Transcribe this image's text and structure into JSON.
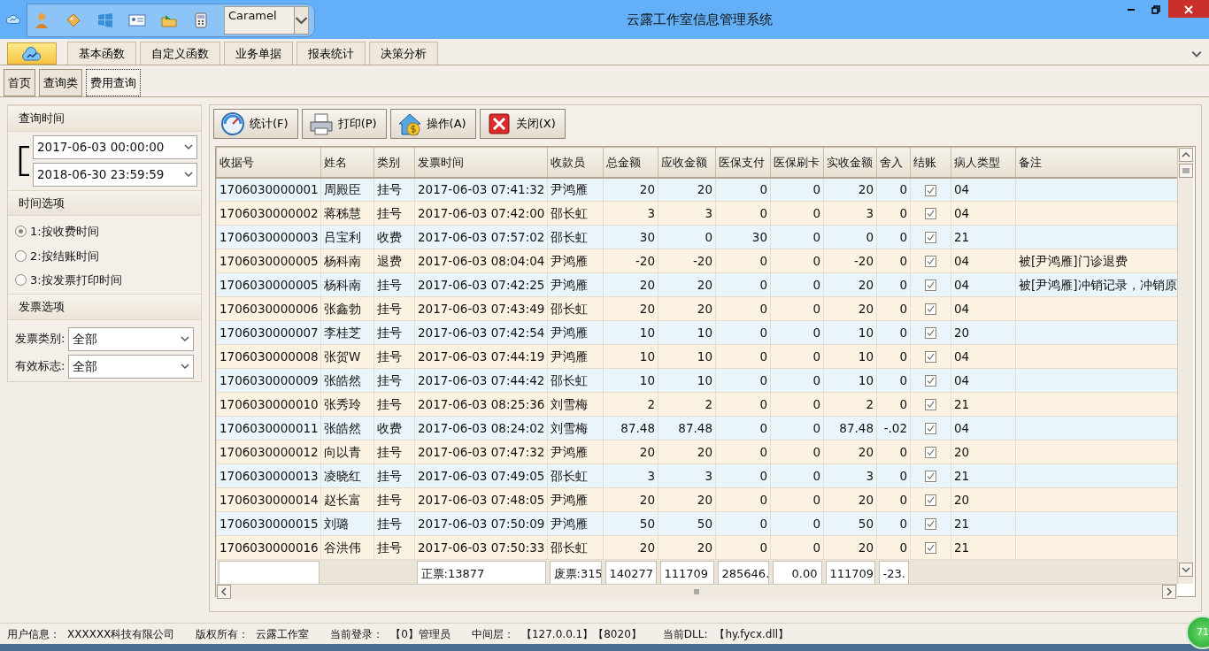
{
  "window": {
    "title": "云露工作室信息管理系统",
    "theme": "Caramel"
  },
  "ribbon_tabs": [
    {
      "label": "基本函数",
      "selected": false
    },
    {
      "label": "自定义函数",
      "selected": false
    },
    {
      "label": "业务单据",
      "selected": false
    },
    {
      "label": "报表统计",
      "selected": false
    },
    {
      "label": "决策分析",
      "selected": false
    }
  ],
  "doc_tabs": [
    {
      "label": "首页",
      "selected": false
    },
    {
      "label": "查询类",
      "selected": false
    },
    {
      "label": "费用查询",
      "selected": true
    }
  ],
  "query_time": {
    "title": "查询时间",
    "start": "2017-06-03 00:00:00",
    "end": "2018-06-30 23:59:59"
  },
  "time_options": {
    "title": "时间选项",
    "options": [
      {
        "label": "1:按收费时间",
        "selected": true
      },
      {
        "label": "2:按结账时间",
        "selected": false
      },
      {
        "label": "3:按发票打印时间",
        "selected": false
      }
    ]
  },
  "invoice_options": {
    "title": "发票选项",
    "fields": [
      {
        "label": "发票类别:",
        "value": "全部"
      },
      {
        "label": "有效标志:",
        "value": "全部"
      }
    ]
  },
  "toolbar": [
    {
      "label": "统计(F)",
      "kind": "stats"
    },
    {
      "label": "打印(P)",
      "kind": "print"
    },
    {
      "label": "操作(A)",
      "kind": "operate"
    },
    {
      "label": "关闭(X)",
      "kind": "close"
    }
  ],
  "table": {
    "columns": [
      {
        "label": "收据号",
        "kind": "text"
      },
      {
        "label": "姓名",
        "kind": "text"
      },
      {
        "label": "类别",
        "kind": "text"
      },
      {
        "label": "发票时间",
        "kind": "text"
      },
      {
        "label": "收款员",
        "kind": "text"
      },
      {
        "label": "总金额",
        "kind": "number"
      },
      {
        "label": "应收金额",
        "kind": "number"
      },
      {
        "label": "医保支付",
        "kind": "number"
      },
      {
        "label": "医保刷卡",
        "kind": "number"
      },
      {
        "label": "实收金额",
        "kind": "number"
      },
      {
        "label": "舍入",
        "kind": "number"
      },
      {
        "label": "结账",
        "kind": "check"
      },
      {
        "label": "病人类型",
        "kind": "text"
      },
      {
        "label": "备注",
        "kind": "text"
      }
    ],
    "rows": [
      {
        "cells": [
          "1706030000001",
          "周殿臣",
          "挂号",
          "2017-06-03 07:41:32",
          "尹鸿雁",
          "20",
          "20",
          "0",
          "0",
          "20",
          "0",
          "",
          "04"
        ],
        "settled": true
      },
      {
        "cells": [
          "1706030000002",
          "蒋秭慧",
          "挂号",
          "2017-06-03 07:42:00",
          "邵长虹",
          "3",
          "3",
          "0",
          "0",
          "3",
          "0",
          "",
          "04"
        ],
        "settled": true
      },
      {
        "cells": [
          "1706030000003",
          "吕宝利",
          "收费",
          "2017-06-03 07:57:02",
          "邵长虹",
          "30",
          "0",
          "30",
          "0",
          "0",
          "0",
          "",
          "21"
        ],
        "settled": true
      },
      {
        "cells": [
          "1706030000005",
          "杨科南",
          "退费",
          "2017-06-03 08:04:04",
          "尹鸿雁",
          "-20",
          "-20",
          "0",
          "0",
          "-20",
          "0",
          "",
          "04",
          "被[尹鸿雁]门诊退费"
        ],
        "settled": true
      },
      {
        "cells": [
          "1706030000005",
          "杨科南",
          "挂号",
          "2017-06-03 07:42:25",
          "尹鸿雁",
          "20",
          "20",
          "0",
          "0",
          "20",
          "0",
          "",
          "04",
          "被[尹鸿雁]冲销记录，冲销原"
        ],
        "settled": true
      },
      {
        "cells": [
          "1706030000006",
          "张鑫勃",
          "挂号",
          "2017-06-03 07:43:49",
          "邵长虹",
          "20",
          "20",
          "0",
          "0",
          "20",
          "0",
          "",
          "04"
        ],
        "settled": true
      },
      {
        "cells": [
          "1706030000007",
          "李桂芝",
          "挂号",
          "2017-06-03 07:42:54",
          "尹鸿雁",
          "10",
          "10",
          "0",
          "0",
          "10",
          "0",
          "",
          "20"
        ],
        "settled": true
      },
      {
        "cells": [
          "1706030000008",
          "张贺W",
          "挂号",
          "2017-06-03 07:44:19",
          "尹鸿雁",
          "10",
          "10",
          "0",
          "0",
          "10",
          "0",
          "",
          "04"
        ],
        "settled": true
      },
      {
        "cells": [
          "1706030000009",
          "张皓然",
          "挂号",
          "2017-06-03 07:44:42",
          "邵长虹",
          "10",
          "10",
          "0",
          "0",
          "10",
          "0",
          "",
          "04"
        ],
        "settled": true
      },
      {
        "cells": [
          "1706030000010",
          "张秀玲",
          "挂号",
          "2017-06-03 08:25:36",
          "刘雪梅",
          "2",
          "2",
          "0",
          "0",
          "2",
          "0",
          "",
          "21"
        ],
        "settled": true
      },
      {
        "cells": [
          "1706030000011",
          "张皓然",
          "收费",
          "2017-06-03 08:24:02",
          "刘雪梅",
          "87.48",
          "87.48",
          "0",
          "0",
          "87.48",
          "-.02",
          "",
          "04"
        ],
        "settled": true
      },
      {
        "cells": [
          "1706030000012",
          "向以青",
          "挂号",
          "2017-06-03 07:47:32",
          "尹鸿雁",
          "20",
          "20",
          "0",
          "0",
          "20",
          "0",
          "",
          "20"
        ],
        "settled": true
      },
      {
        "cells": [
          "1706030000013",
          "凌晓红",
          "挂号",
          "2017-06-03 07:49:05",
          "邵长虹",
          "3",
          "3",
          "0",
          "0",
          "3",
          "0",
          "",
          "21"
        ],
        "settled": true
      },
      {
        "cells": [
          "1706030000014",
          "赵长富",
          "挂号",
          "2017-06-03 07:48:05",
          "尹鸿雁",
          "20",
          "20",
          "0",
          "0",
          "20",
          "0",
          "",
          "20"
        ],
        "settled": true
      },
      {
        "cells": [
          "1706030000015",
          "刘璐",
          "挂号",
          "2017-06-03 07:50:09",
          "尹鸿雁",
          "50",
          "50",
          "0",
          "0",
          "50",
          "0",
          "",
          "21"
        ],
        "settled": true
      },
      {
        "cells": [
          "1706030000016",
          "谷洪伟",
          "挂号",
          "2017-06-03 07:50:33",
          "邵长虹",
          "20",
          "20",
          "0",
          "0",
          "20",
          "0",
          "",
          "21"
        ],
        "settled": true
      }
    ],
    "totals": [
      {
        "kind": "field"
      },
      {
        "kind": "blank"
      },
      {
        "kind": "blank"
      },
      {
        "kind": "field",
        "text": "正票:13877"
      },
      {
        "kind": "field",
        "text": "废票:315"
      },
      {
        "kind": "field",
        "text": "140277"
      },
      {
        "kind": "field",
        "text": "111709"
      },
      {
        "kind": "field",
        "text": "285646."
      },
      {
        "kind": "number",
        "text": "0.00"
      },
      {
        "kind": "field",
        "text": "111709"
      },
      {
        "kind": "field",
        "text": "-23."
      },
      {
        "kind": "blank"
      },
      {
        "kind": "blank"
      },
      {
        "kind": "blank"
      }
    ]
  },
  "status_bar": [
    {
      "label": "用户信息：",
      "value": "XXXXXX科技有限公司"
    },
    {
      "label": "版权所有：",
      "value": "云露工作室"
    },
    {
      "label": "当前登录：",
      "value": "【0】管理员"
    },
    {
      "label": "中间层：",
      "value": "【127.0.0.1】【8020】"
    },
    {
      "label": "当前DLL:",
      "value": "【hy.fycx.dll】"
    }
  ],
  "badge": "71"
}
